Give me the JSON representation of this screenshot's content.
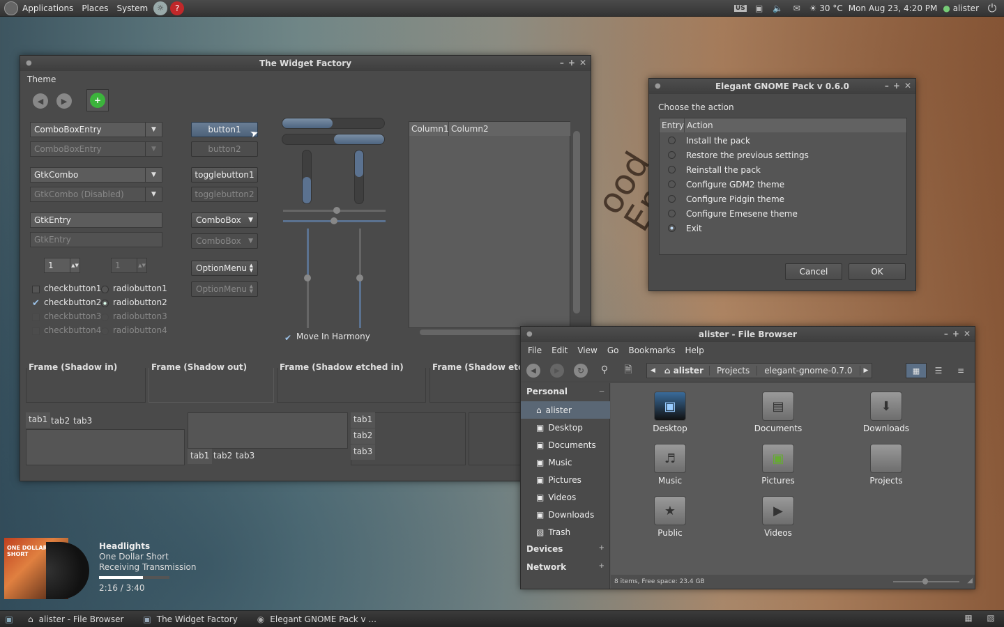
{
  "topbar": {
    "menus": [
      "Applications",
      "Places",
      "System"
    ],
    "keyboard": "US",
    "weather": "30 °C",
    "datetime": "Mon Aug 23,  4:20 PM",
    "user": "alister"
  },
  "desktop": {
    "background_text": "ood Eng"
  },
  "widget_factory": {
    "title": "The Widget Factory",
    "menu": "Theme",
    "comboentry1": "ComboBoxEntry",
    "comboentry2": "ComboBoxEntry",
    "gtkcombo": "GtkCombo",
    "gtkcombo_dis": "GtkCombo (Disabled)",
    "entry1": "GtkEntry",
    "entry2": "GtkEntry",
    "spin1": "1",
    "spin2": "1",
    "checks": [
      "checkbutton1",
      "checkbutton2",
      "checkbutton3",
      "checkbutton4"
    ],
    "radios": [
      "radiobutton1",
      "radiobutton2",
      "radiobutton3",
      "radiobutton4"
    ],
    "button1": "button1",
    "button2": "button2",
    "toggle1": "togglebutton1",
    "toggle2": "togglebutton2",
    "combobox1": "ComboBox",
    "combobox2": "ComboBox",
    "option1": "OptionMenu",
    "option2": "OptionMenu",
    "harmony": "Move In Harmony",
    "col1": "Column1",
    "col2": "Column2",
    "frames": [
      "Frame (Shadow in)",
      "Frame (Shadow out)",
      "Frame (Shadow etched in)",
      "Frame (Shadow etche"
    ],
    "tabs": [
      "tab1",
      "tab2",
      "tab3"
    ]
  },
  "egp": {
    "title": "Elegant GNOME Pack v 0.6.0",
    "prompt": "Choose the action",
    "col_entry": "Entry",
    "col_action": "Action",
    "actions": [
      "Install the pack",
      "Restore the previous settings",
      "Reinstall the pack",
      "Configure GDM2 theme",
      "Configure Pidgin theme",
      "Configure Emesene theme",
      "Exit"
    ],
    "cancel": "Cancel",
    "ok": "OK"
  },
  "filebrowser": {
    "title": "alister - File Browser",
    "menus": [
      "File",
      "Edit",
      "View",
      "Go",
      "Bookmarks",
      "Help"
    ],
    "crumbs": [
      "alister",
      "Projects",
      "elegant-gnome-0.7.0"
    ],
    "personal": "Personal",
    "sidebar": [
      "alister",
      "Desktop",
      "Documents",
      "Music",
      "Pictures",
      "Videos",
      "Downloads",
      "Trash"
    ],
    "devices": "Devices",
    "network": "Network",
    "items": [
      "Desktop",
      "Documents",
      "Downloads",
      "Music",
      "Pictures",
      "Projects",
      "Public",
      "Videos"
    ],
    "status": "8 items, Free space: 23.4 GB"
  },
  "music": {
    "title": "Headlights",
    "artist": "One Dollar Short",
    "album": "Receiving Transmission",
    "time": "2:16 / 3:40",
    "progress": 0.62,
    "cover_text": "ONE DOLLAR SHORT"
  },
  "taskbar": [
    "alister - File Browser",
    "The Widget Factory",
    "Elegant GNOME Pack v ..."
  ]
}
